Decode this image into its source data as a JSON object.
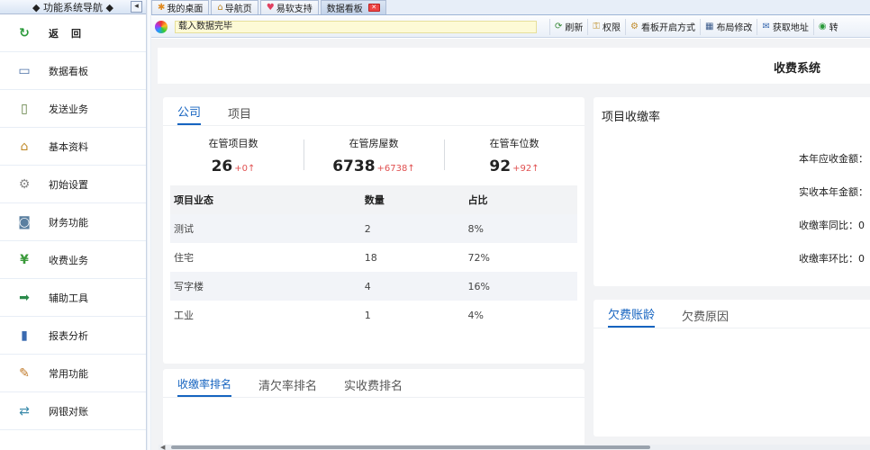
{
  "sidebar": {
    "title": "◆ 功能系统导航 ◆",
    "collapse": "◂",
    "back_label": "返回",
    "back_icon": "↻",
    "items": [
      {
        "label": "数据看板",
        "icon": "▭"
      },
      {
        "label": "发送业务",
        "icon": "▯"
      },
      {
        "label": "基本资料",
        "icon": "⌂"
      },
      {
        "label": "初始设置",
        "icon": "⚙"
      },
      {
        "label": "财务功能",
        "icon": "◙"
      },
      {
        "label": "收费业务",
        "icon": "¥"
      },
      {
        "label": "辅助工具",
        "icon": "➡"
      },
      {
        "label": "报表分析",
        "icon": "▮"
      },
      {
        "label": "常用功能",
        "icon": "✎"
      },
      {
        "label": "网银对账",
        "icon": "⇄"
      }
    ]
  },
  "tabs": [
    {
      "label": "我的桌面",
      "icon": "✱"
    },
    {
      "label": "导航页",
      "icon": "⌂"
    },
    {
      "label": "易软支持",
      "icon": "♥"
    },
    {
      "label": "数据看板",
      "close": "✕"
    }
  ],
  "toolbar": {
    "status": "载入数据完毕",
    "buttons": [
      {
        "label": "刷新",
        "icon": "⟳"
      },
      {
        "label": "权限",
        "icon": "⚿"
      },
      {
        "label": "看板开启方式",
        "icon": "⚙"
      },
      {
        "label": "布局修改",
        "icon": "▦"
      },
      {
        "label": "获取地址",
        "icon": "✉"
      },
      {
        "label": "转",
        "icon": "◉"
      }
    ]
  },
  "page_title": "收费系统",
  "company_card": {
    "tabs": [
      "公司",
      "项目"
    ],
    "kpis": [
      {
        "label": "在管项目数",
        "value": "26",
        "delta": "+0↑"
      },
      {
        "label": "在管房屋数",
        "value": "6738",
        "delta": "+6738↑"
      },
      {
        "label": "在管车位数",
        "value": "92",
        "delta": "+92↑"
      }
    ],
    "table": {
      "headers": [
        "项目业态",
        "数量",
        "占比"
      ],
      "rows": [
        [
          "测试",
          "2",
          "8%"
        ],
        [
          "住宅",
          "18",
          "72%"
        ],
        [
          "写字楼",
          "4",
          "16%"
        ],
        [
          "工业",
          "1",
          "4%"
        ]
      ]
    }
  },
  "collection_card": {
    "title": "项目收缴率",
    "rows": [
      "本年应收金额：",
      "实收本年金额：",
      "收缴率同比：0",
      "收缴率环比：0"
    ]
  },
  "ranking_card": {
    "tabs": [
      "收缴率排名",
      "清欠率排名",
      "实收费排名"
    ]
  },
  "arrears_card": {
    "tabs": [
      "欠费账龄",
      "欠费原因"
    ]
  }
}
